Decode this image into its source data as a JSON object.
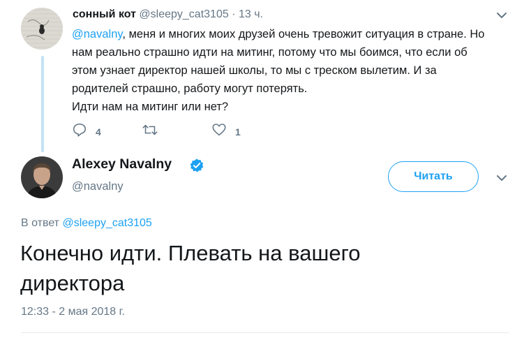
{
  "reply_tweet": {
    "author_name": "сонный кот",
    "author_handle": "@sleepy_cat3105",
    "dot": "·",
    "time": "13 ч.",
    "mention": "@navalny",
    "text_line1_rest": ", меня и многих моих друзей очень тревожит ситуация в стране. Но",
    "text_line2": "нам реально страшно идти на митинг, потому что мы боимся, что если об",
    "text_line3": "этом узнает директор нашей школы, то мы с треском вылетим. И за",
    "text_line4": "родителей страшно, работу могут потерять.",
    "text_line5": "Идти нам на митинг или нет?",
    "reply_count": "4",
    "retweet_count": "",
    "like_count": "1",
    "icons": {
      "reply": "reply-icon",
      "retweet": "retweet-icon",
      "like": "heart-icon",
      "menu": "chevron-down-icon"
    }
  },
  "main_tweet": {
    "author_name": "Alexey Navalny",
    "author_handle": "@navalny",
    "follow_label": "Читать",
    "in_reply_prefix": "В ответ",
    "in_reply_handle": "@sleepy_cat3105",
    "text_line1": "Конечно идти. Плевать на вашего",
    "text_line2": "директора",
    "timestamp": "12:33 - 2 мая 2018 г.",
    "icons": {
      "verified": "verified-badge-icon",
      "menu": "chevron-down-icon"
    }
  },
  "colors": {
    "accent": "#1da1f2",
    "muted": "#657786",
    "text": "#14171a",
    "thread_line": "#c4e2f5"
  }
}
